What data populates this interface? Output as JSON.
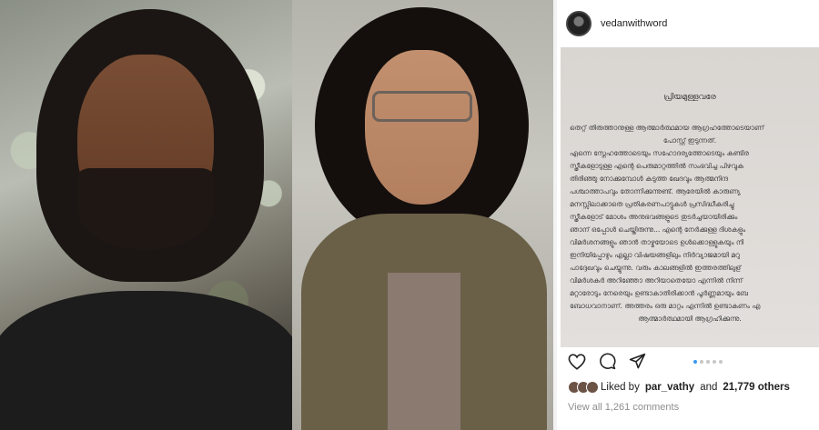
{
  "post": {
    "username": "vedanwithword",
    "title": "പ്രിയമുള്ളവരേ",
    "lines": [
      "തെറ്റ് തിരുത്താനുള്ള ആത്മാർത്ഥമായ ആഗ്രഹത്തോടെയാണ്",
      "പോസ്റ്റ് ഇടുന്നത്.",
      "എന്നെ സ്നേഹത്തോടെയും സഹോദര്യത്തോടെയും കണ്ടിര",
      "സ്ത്രീകളോടുള്ള   എന്റെ പെരുമാറ്റത്തിൽ സംഭവിച്ച പിഴവുക",
      "തിരിഞ്ഞു നോക്കുമ്പോൾ കടുത്ത ഖേദവും ആത്മനിന്ദ",
      "പശ്ചാത്താപവും തോന്നിക്കുന്നുണ്ട്. ആരേയിൽ കാരുണ്യ",
      "മനസ്സിലാക്കാതെ പ്രതികരണപാട്ടുകൾ പ്രസിദ്ധീകരിച്ചു",
      "സ്ത്രീകളോട് മോശം അനുഭവങ്ങളുടെ തുടർച്ചയായിരിക്കും",
      "ഞാന് ഒപ്പോൾ ചെയ്തിരുന്നു... എന്റെ നേർക്കുള്ള ദിശകളും",
      "വിമർശനങ്ങളും   ഞാൻ താഴ്മയോടെ ഉൾക്കൊള്ളുകയും നി",
      "ഇനിയിപ്പോഴും എല്ലാ വിഷയങ്ങളിലും നിർവ്യാജമായി മറു",
      "പാദ്ദേഖവും ചെയ്യുന്നു. വരും കാലങ്ങളിൽ ഇത്തരത്തിലുള്",
      "വിമർശകർ അറിഞ്ഞോ അറിയാതെയോ എന്നിൽ നിന്ന്",
      "മറ്റാരോടും നേരെയും ഉണ്ടാകാതിരിക്കാൻ പൂർണ്ണമായും ബേ",
      "ബോധവാനാണ്. അത്തരം ഒരു മാറ്റം എന്നിൽ ഉണ്ടാകണം എ",
      "ആത്മാർത്ഥമായി ആഗ്രഹിക്കുന്നു."
    ]
  },
  "likes": {
    "prefix": "Liked by",
    "user": "par_vathy",
    "connector": "and",
    "count": "21,779 others"
  },
  "comments": {
    "label": "View all 1,261 comments"
  },
  "carousel": {
    "total": 5,
    "active_index": 0
  },
  "icons": [
    "heart-icon",
    "comment-icon",
    "share-icon"
  ],
  "colors": {
    "accent": "#3897f0",
    "muted": "#8e8e8e"
  }
}
